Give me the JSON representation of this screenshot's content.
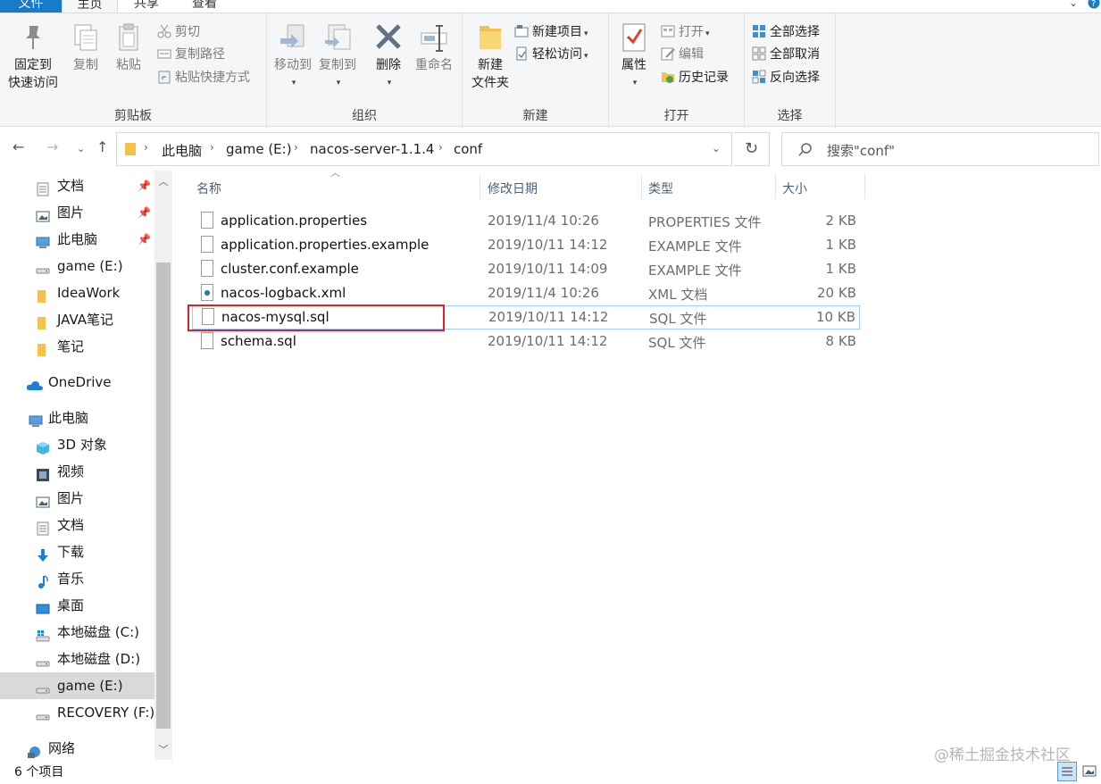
{
  "ribbon_tabs": {
    "file": "文件",
    "home": "主页",
    "share": "共享",
    "view": "查看"
  },
  "clipboard": {
    "title": "剪贴板",
    "pin_quick_access_line1": "固定到",
    "pin_quick_access_line2": "快速访问",
    "copy": "复制",
    "paste": "粘贴",
    "cut": "剪切",
    "copy_path": "复制路径",
    "paste_shortcut": "粘贴快捷方式"
  },
  "organize": {
    "title": "组织",
    "move_to": "移动到",
    "copy_to": "复制到",
    "delete": "删除",
    "rename": "重命名"
  },
  "new_group": {
    "title": "新建",
    "new_folder_line1": "新建",
    "new_folder_line2": "文件夹",
    "new_item": "新建项目",
    "easy_access": "轻松访问"
  },
  "open_group": {
    "title": "打开",
    "properties": "属性",
    "open": "打开",
    "edit": "编辑",
    "history": "历史记录"
  },
  "select_group": {
    "title": "选择",
    "select_all": "全部选择",
    "select_none": "全部取消",
    "invert": "反向选择"
  },
  "address": {
    "crumbs": [
      "此电脑",
      "game (E:)",
      "nacos-server-1.1.4",
      "conf"
    ],
    "search_placeholder": "搜索\"conf\""
  },
  "sidebar": {
    "items": [
      {
        "label": "文档",
        "icon": "document-icon",
        "pinned": true
      },
      {
        "label": "图片",
        "icon": "pictures-icon",
        "pinned": true
      },
      {
        "label": "此电脑",
        "icon": "computer-icon",
        "pinned": true
      },
      {
        "label": "game (E:)",
        "icon": "drive-icon"
      },
      {
        "label": "IdeaWork",
        "icon": "folder-icon"
      },
      {
        "label": "JAVA笔记",
        "icon": "folder-icon"
      },
      {
        "label": "笔记",
        "icon": "folder-icon"
      },
      {
        "label": "OneDrive",
        "icon": "cloud-icon"
      },
      {
        "label": "此电脑",
        "icon": "computer-icon"
      },
      {
        "label": "3D 对象",
        "icon": "3d-objects-icon"
      },
      {
        "label": "视频",
        "icon": "video-icon"
      },
      {
        "label": "图片",
        "icon": "pictures-icon"
      },
      {
        "label": "文档",
        "icon": "document-icon"
      },
      {
        "label": "下载",
        "icon": "download-icon"
      },
      {
        "label": "音乐",
        "icon": "music-icon"
      },
      {
        "label": "桌面",
        "icon": "desktop-icon"
      },
      {
        "label": "本地磁盘 (C:)",
        "icon": "windows-drive-icon"
      },
      {
        "label": "本地磁盘 (D:)",
        "icon": "drive-icon"
      },
      {
        "label": "game (E:)",
        "icon": "drive-icon",
        "selected": true
      },
      {
        "label": "RECOVERY (F:)",
        "icon": "drive-icon"
      },
      {
        "label": "网络",
        "icon": "network-icon"
      }
    ]
  },
  "columns": {
    "name": "名称",
    "modified": "修改日期",
    "type": "类型",
    "size": "大小"
  },
  "files": [
    {
      "name": "application.properties",
      "modified": "2019/11/4 10:26",
      "type": "PROPERTIES 文件",
      "size": "2 KB"
    },
    {
      "name": "application.properties.example",
      "modified": "2019/10/11 14:12",
      "type": "EXAMPLE 文件",
      "size": "1 KB"
    },
    {
      "name": "cluster.conf.example",
      "modified": "2019/10/11 14:09",
      "type": "EXAMPLE 文件",
      "size": "1 KB"
    },
    {
      "name": "nacos-logback.xml",
      "modified": "2019/11/4 10:26",
      "type": "XML 文档",
      "size": "20 KB"
    },
    {
      "name": "nacos-mysql.sql",
      "modified": "2019/10/11 14:12",
      "type": "SQL 文件",
      "size": "10 KB"
    },
    {
      "name": "schema.sql",
      "modified": "2019/10/11 14:12",
      "type": "SQL 文件",
      "size": "8 KB"
    }
  ],
  "status": {
    "item_count": "6 个项目"
  },
  "watermark": "@稀土掘金技术社区",
  "colors": {
    "accent": "#1979ca",
    "highlight_border": "#e0202a",
    "hover_border": "#99d1ff"
  }
}
